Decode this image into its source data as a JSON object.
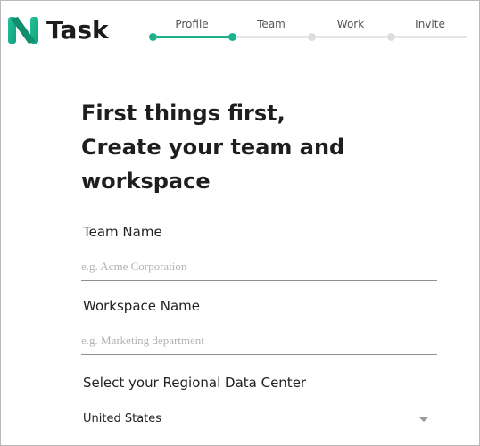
{
  "brand": {
    "name": "Task",
    "accent_color": "#1ab28a"
  },
  "stepper": {
    "steps": [
      {
        "label": "Profile",
        "state": "complete"
      },
      {
        "label": "Team",
        "state": "current"
      },
      {
        "label": "Work",
        "state": "upcoming"
      },
      {
        "label": "Invite",
        "state": "upcoming"
      }
    ]
  },
  "main": {
    "title_lines": [
      "First things first,",
      "Create your team and",
      "workspace"
    ],
    "team_name": {
      "label": "Team Name",
      "placeholder": "e.g. Acme Corporation",
      "value": ""
    },
    "workspace_name": {
      "label": "Workspace Name",
      "placeholder": "e.g. Marketing department",
      "value": ""
    },
    "data_center": {
      "label": "Select your Regional Data Center",
      "selected": "United States",
      "icon": "chevron-down-icon"
    }
  }
}
